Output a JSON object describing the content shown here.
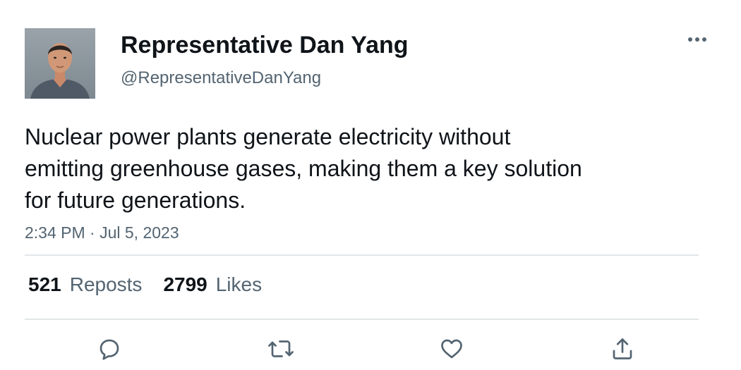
{
  "author": {
    "display_name": "Representative Dan Yang",
    "handle": "@RepresentativeDanYang"
  },
  "tweet": {
    "text": "Nuclear power plants generate electricity without\nemitting greenhouse gases, making them a key solution\nfor future generations.",
    "timestamp": "2:34 PM · Jul 5, 2023"
  },
  "stats": {
    "reposts_count": "521",
    "reposts_label": "Reposts",
    "likes_count": "2799",
    "likes_label": "Likes"
  },
  "icons": {
    "more": "more-horizontal-icon",
    "reply": "reply-icon",
    "repost": "repost-icon",
    "like": "heart-icon",
    "share": "share-icon"
  },
  "colors": {
    "text_primary": "#0f1419",
    "text_secondary": "#536471",
    "divider": "#e3e6e8"
  }
}
